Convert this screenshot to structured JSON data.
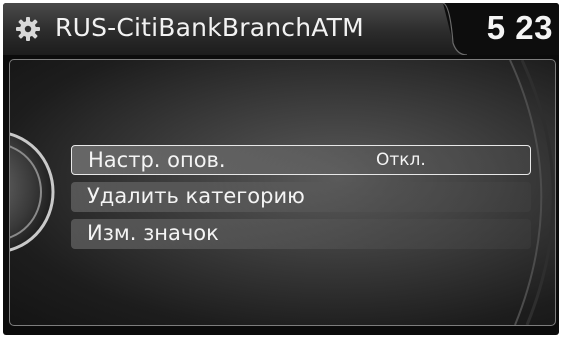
{
  "header": {
    "icon": "gear-icon",
    "title": "RUS-CitiBankBranchATM",
    "clock": "5 23"
  },
  "menu": {
    "items": [
      {
        "label": "Настр. опов.",
        "value": "Откл.",
        "selected": true
      },
      {
        "label": "Удалить категорию",
        "value": "",
        "selected": false
      },
      {
        "label": "Изм. значок",
        "value": "",
        "selected": false
      }
    ]
  },
  "colors": {
    "background": "#0b0b0b",
    "text": "#f4f4f4",
    "selection_border": "#e8e8e8"
  }
}
